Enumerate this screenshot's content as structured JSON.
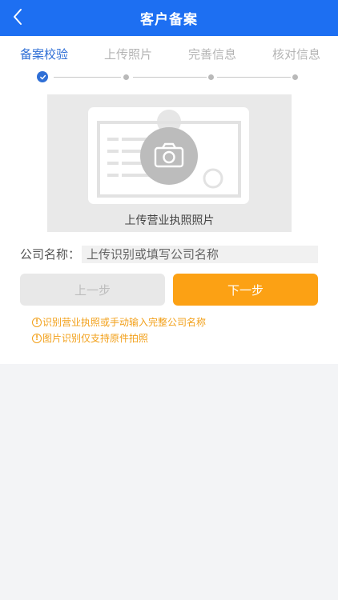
{
  "header": {
    "title": "客户备案"
  },
  "steps": [
    {
      "label": "备案校验",
      "active": true
    },
    {
      "label": "上传照片",
      "active": false
    },
    {
      "label": "完善信息",
      "active": false
    },
    {
      "label": "核对信息",
      "active": false
    }
  ],
  "upload": {
    "text": "上传营业执照照片"
  },
  "company": {
    "label": "公司名称：",
    "placeholder": "上传识别或填写公司名称",
    "value": ""
  },
  "buttons": {
    "prev": "上一步",
    "next": "下一步"
  },
  "tips": [
    "识别营业执照或手动输入完整公司名称",
    "图片识别仅支持原件拍照"
  ],
  "colors": {
    "primary": "#1d6ff2",
    "accent": "#fca114",
    "warning_text": "#f2a01a"
  }
}
